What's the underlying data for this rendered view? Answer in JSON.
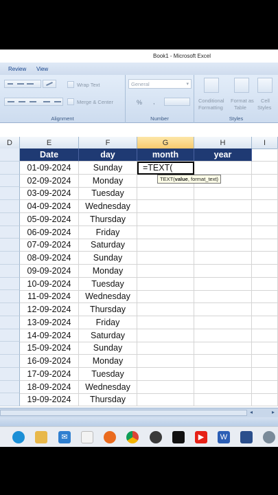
{
  "window": {
    "title": "Book1 - Microsoft Excel"
  },
  "ribbon": {
    "tabs": [
      "Review",
      "View"
    ],
    "alignment": {
      "wrap_text": "Wrap Text",
      "merge_center": "Merge & Center",
      "label": "Alignment"
    },
    "number": {
      "format": "General",
      "currency": "%",
      "comma": ",",
      "label": "Number"
    },
    "styles": {
      "conditional": "Conditional",
      "formatting": "Formatting",
      "format_as": "Format as",
      "table": "Table",
      "cell": "Cell",
      "cell_styles": "Styles",
      "label": "Styles"
    }
  },
  "grid": {
    "columns": [
      "D",
      "E",
      "F",
      "G",
      "H",
      "I"
    ],
    "selected_column": "G",
    "headers": {
      "date": "Date",
      "day": "day",
      "month": "month",
      "year": "year"
    },
    "active_cell_value": "=TEXT(",
    "tooltip": {
      "fn": "TEXT(",
      "arg1": "value",
      "rest": ", format_text)"
    },
    "rows": [
      {
        "date": "01-09-2024",
        "day": "Sunday"
      },
      {
        "date": "02-09-2024",
        "day": "Monday"
      },
      {
        "date": "03-09-2024",
        "day": "Tuesday"
      },
      {
        "date": "04-09-2024",
        "day": "Wednesday"
      },
      {
        "date": "05-09-2024",
        "day": "Thursday"
      },
      {
        "date": "06-09-2024",
        "day": "Friday"
      },
      {
        "date": "07-09-2024",
        "day": "Saturday"
      },
      {
        "date": "08-09-2024",
        "day": "Sunday"
      },
      {
        "date": "09-09-2024",
        "day": "Monday"
      },
      {
        "date": "10-09-2024",
        "day": "Tuesday"
      },
      {
        "date": "11-09-2024",
        "day": "Wednesday"
      },
      {
        "date": "12-09-2024",
        "day": "Thursday"
      },
      {
        "date": "13-09-2024",
        "day": "Friday"
      },
      {
        "date": "14-09-2024",
        "day": "Saturday"
      },
      {
        "date": "15-09-2024",
        "day": "Sunday"
      },
      {
        "date": "16-09-2024",
        "day": "Monday"
      },
      {
        "date": "17-09-2024",
        "day": "Tuesday"
      },
      {
        "date": "18-09-2024",
        "day": "Wednesday"
      },
      {
        "date": "19-09-2024",
        "day": "Thursday"
      }
    ]
  },
  "taskbar": {
    "apps": [
      "edge-icon",
      "file-explorer-icon",
      "mail-icon",
      "store-icon",
      "firefox-icon",
      "chrome-icon",
      "obs-icon",
      "capcut-icon",
      "youtube-icon",
      "word-icon",
      "pen-icon",
      "settings-icon"
    ]
  },
  "colors": {
    "header_fill": "#1f3a73",
    "ribbon": "#dbe6f3",
    "selected_col": "#f7c96e"
  }
}
